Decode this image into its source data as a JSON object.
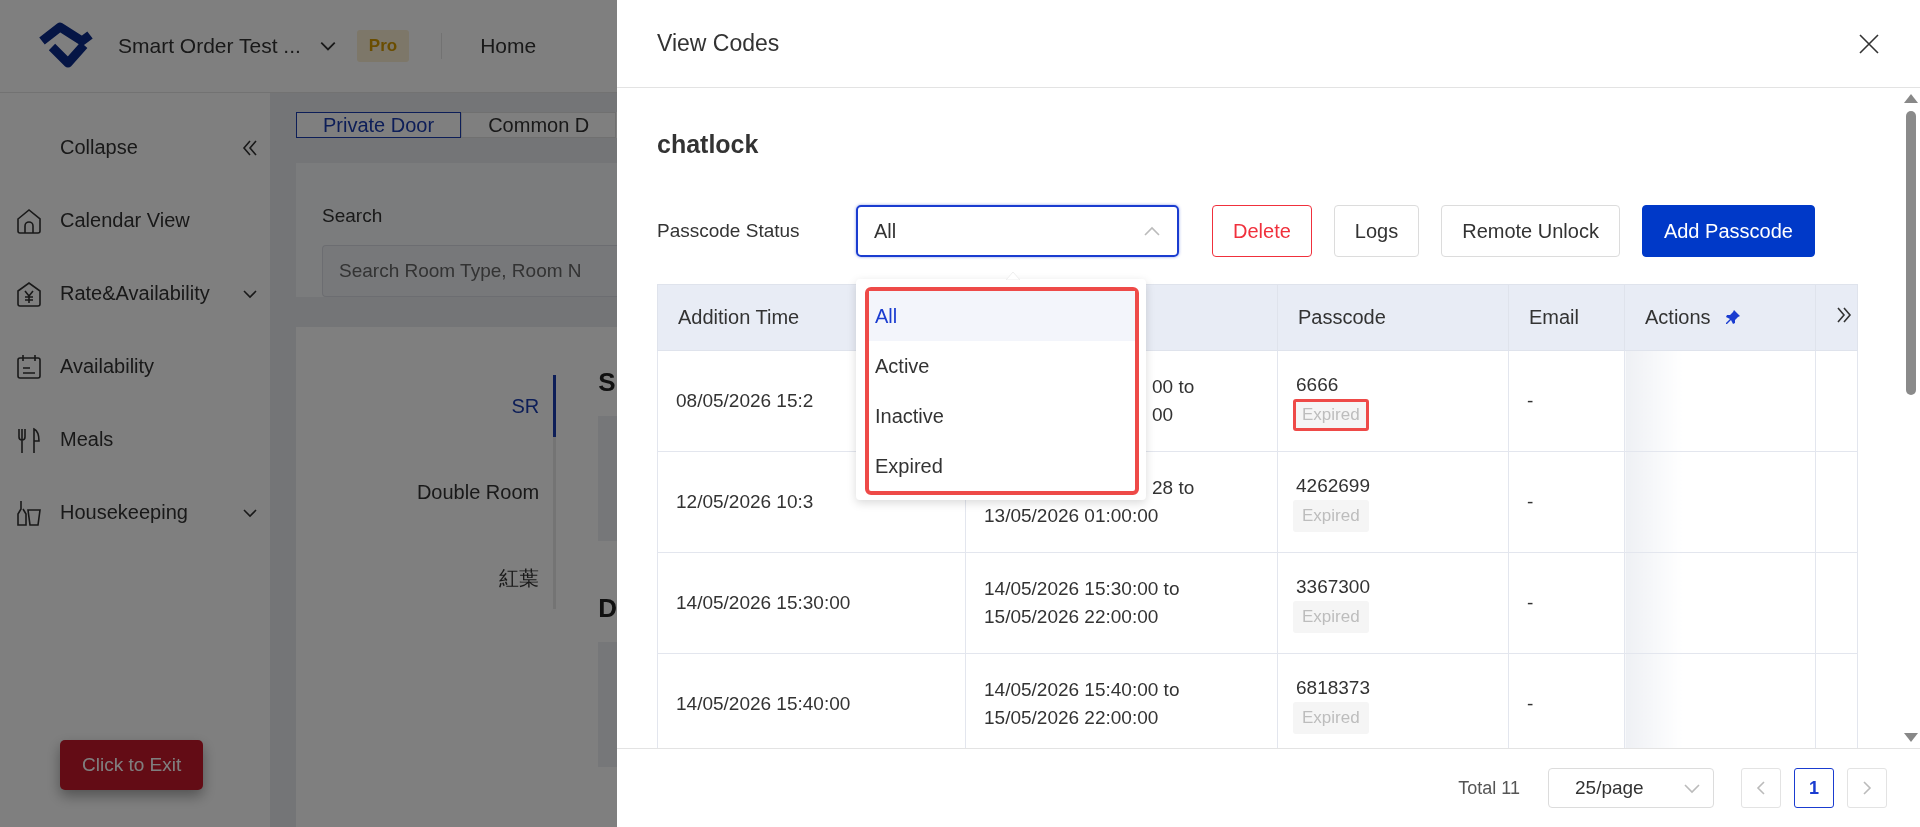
{
  "background_app": {
    "header": {
      "brand": "Smart Order Test ...",
      "badge": "Pro",
      "nav": [
        "Home"
      ]
    },
    "sidebar": {
      "collapse": "Collapse",
      "items": [
        {
          "label": "Calendar View",
          "expandable": false
        },
        {
          "label": "Rate&Availability",
          "expandable": true
        },
        {
          "label": "Availability",
          "expandable": false
        },
        {
          "label": "Meals",
          "expandable": false
        },
        {
          "label": "Housekeeping",
          "expandable": true
        }
      ],
      "exit_button": "Click to Exit"
    },
    "tabs": [
      {
        "label": "Private Door",
        "selected": true
      },
      {
        "label": "Common D",
        "selected": false
      }
    ],
    "search": {
      "label": "Search",
      "placeholder": "Search Room Type, Room N"
    },
    "room_types": [
      {
        "label": "SR",
        "selected": true
      },
      {
        "label": "Double Room",
        "selected": false
      },
      {
        "label": "紅葉",
        "selected": false
      }
    ],
    "sections": [
      "S",
      "D"
    ]
  },
  "drawer": {
    "title": "View Codes",
    "lock_name": "chatlock",
    "filter": {
      "label": "Passcode Status",
      "value": "All",
      "open": true,
      "options": [
        {
          "label": "All",
          "selected": true
        },
        {
          "label": "Active",
          "selected": false
        },
        {
          "label": "Inactive",
          "selected": false
        },
        {
          "label": "Expired",
          "selected": false
        }
      ],
      "highlighted": true
    },
    "buttons": [
      {
        "label": "Delete",
        "kind": "danger"
      },
      {
        "label": "Logs",
        "kind": "default"
      },
      {
        "label": "Remote Unlock",
        "kind": "default"
      },
      {
        "label": "Add Passcode",
        "kind": "primary"
      }
    ],
    "table": {
      "columns": [
        "Addition Time",
        "",
        "Passcode",
        "Email",
        "Actions",
        ""
      ],
      "rows": [
        {
          "addition_time": {
            "text": "08/05/2026 15:2"
          },
          "period": [
            {
              "text": "00 to",
              "clipped": true
            },
            {
              "text": "00",
              "clipped": true
            }
          ],
          "passcode": "6666",
          "status": "Expired",
          "highlighted": true,
          "email": "-"
        },
        {
          "addition_time": {
            "text": "12/05/2026 10:3"
          },
          "period": [
            {
              "text": "28 to",
              "clipped": true
            },
            {
              "text": "13/05/2026 01:00:00",
              "clipped": false
            }
          ],
          "passcode": "4262699",
          "status": "Expired",
          "highlighted": false,
          "email": "-"
        },
        {
          "addition_time": {
            "text": "14/05/2026 15:30:00"
          },
          "period": [
            {
              "text": "14/05/2026 15:30:00 to",
              "clipped": false
            },
            {
              "text": "15/05/2026 22:00:00",
              "clipped": false
            }
          ],
          "passcode": "3367300",
          "status": "Expired",
          "highlighted": false,
          "email": "-"
        },
        {
          "addition_time": {
            "text": "14/05/2026 15:40:00"
          },
          "period": [
            {
              "text": "14/05/2026 15:40:00 to",
              "clipped": false
            },
            {
              "text": "15/05/2026 22:00:00",
              "clipped": false
            }
          ],
          "passcode": "6818373",
          "status": "Expired",
          "highlighted": false,
          "email": "-"
        }
      ]
    },
    "pagination": {
      "total": "Total 11",
      "page_size": "25/page",
      "pages": [
        {
          "label": "1",
          "selected": true
        }
      ]
    }
  }
}
